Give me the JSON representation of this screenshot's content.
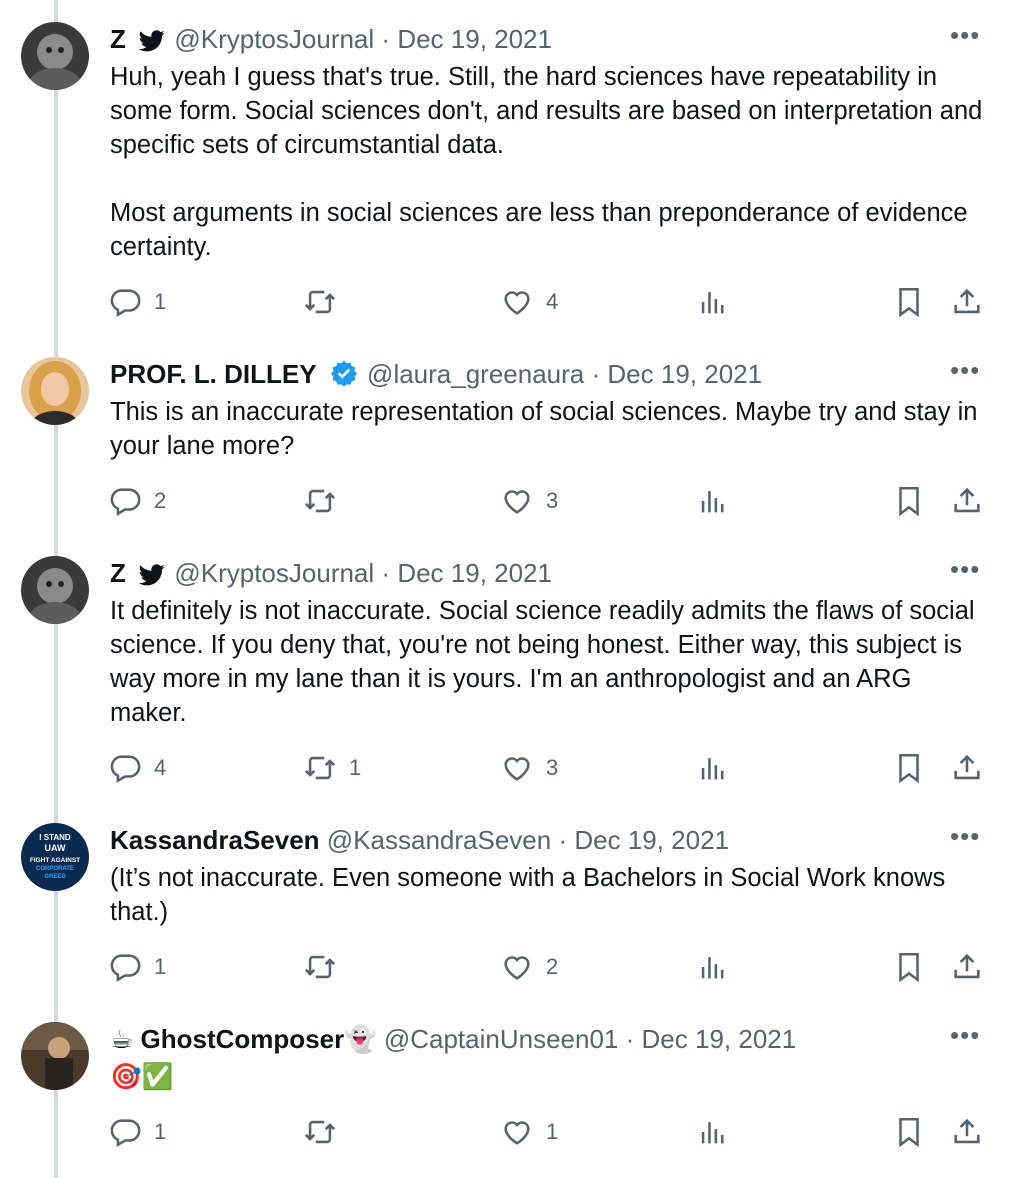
{
  "tweets": [
    {
      "name": "Z",
      "bird": "🐦",
      "handle": "@KryptosJournal",
      "date": "Dec 19, 2021",
      "text": "Huh, yeah I guess that's true. Still, the hard sciences have repeatability in some form. Social sciences don't, and results are based on interpretation and specific sets of circumstantial data.\n\nMost arguments in social sciences are less than preponderance of evidence certainty.",
      "replies": "1",
      "retweets": "",
      "likes": "4"
    },
    {
      "name": "PROF. L. DILLEY",
      "verified": true,
      "handle": "@laura_greenaura",
      "date": "Dec 19, 2021",
      "text": "This is an inaccurate representation of social sciences. Maybe try and stay in your lane more?",
      "replies": "2",
      "retweets": "",
      "likes": "3"
    },
    {
      "name": "Z",
      "handle": "@KryptosJournal",
      "date": "Dec 19, 2021",
      "text": "It definitely is not inaccurate. Social science readily admits the flaws of social science. If you deny that, you're not being honest. Either way, this subject is way more in my lane than it is yours. I'm an anthropologist and an ARG maker.",
      "replies": "4",
      "retweets": "1",
      "likes": "3"
    },
    {
      "name": "KassandraSeven",
      "handle": "@KassandraSeven",
      "date": "Dec 19, 2021",
      "text": "(It’s not inaccurate. Even someone with a Bachelors in Social Work knows that.)",
      "replies": "1",
      "retweets": "",
      "likes": "2",
      "avatar_text": [
        "I STAND",
        "UAW",
        "FIGHT AGAINST",
        "CORPORATE",
        "GREED"
      ]
    },
    {
      "name": "GhostComposer",
      "name_prefix_emoji": "☕",
      "name_suffix_emoji": "👻",
      "handle": "@CaptainUnseen01",
      "date": "Dec 19, 2021",
      "text": "🎯✅",
      "replies": "1",
      "retweets": "",
      "likes": "1"
    }
  ],
  "separator": "·",
  "more_label": "•••",
  "colors": {
    "text": "#0f1419",
    "secondary": "#536471",
    "verified": "#1d9bf0",
    "thread_line": "#cfd9de"
  }
}
